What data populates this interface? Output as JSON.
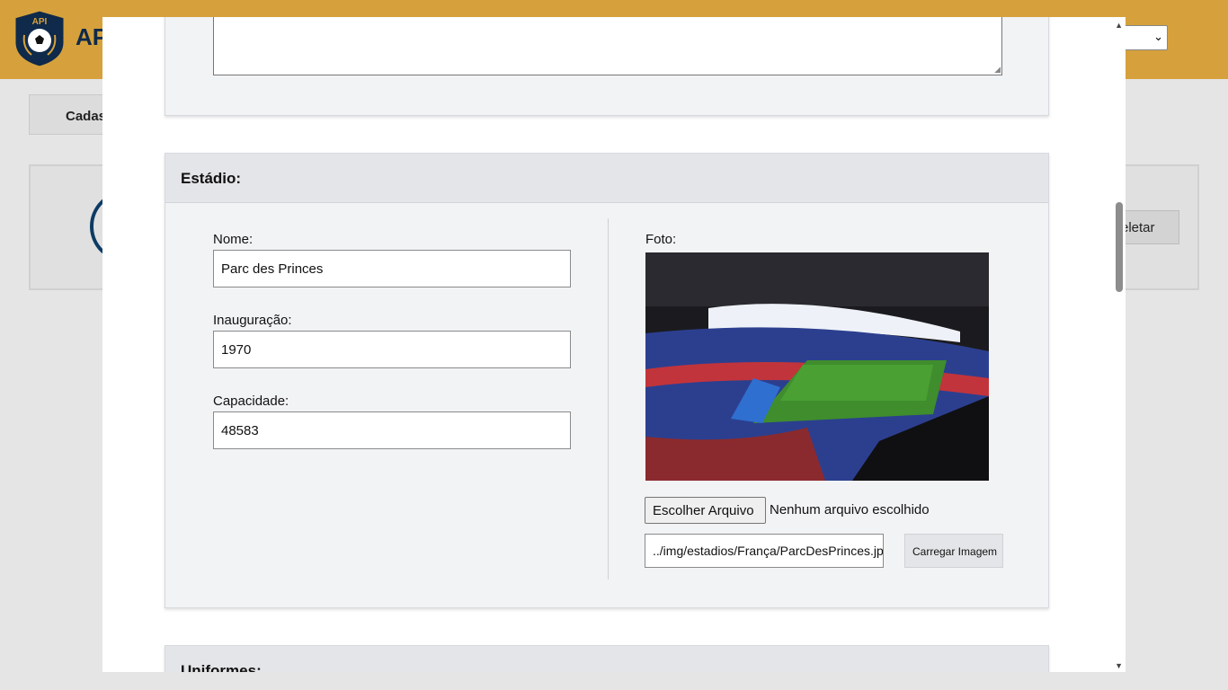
{
  "background": {
    "app_title": "API",
    "logo_text": "API",
    "tab_label": "Cadas",
    "delete_label": "eletar"
  },
  "stadium": {
    "header": "Estádio:",
    "name_label": "Nome:",
    "name_value": "Parc des Princes",
    "inauguration_label": "Inauguração:",
    "inauguration_value": "1970",
    "capacity_label": "Capacidade:",
    "capacity_value": "48583",
    "photo_label": "Foto:",
    "choose_file_label": "Escolher Arquivo",
    "file_status": "Nenhum arquivo escolhido",
    "image_path": "../img/estadios/França/ParcDesPrinces.jpg",
    "load_image_label": "Carregar Imagem"
  },
  "uniforms": {
    "header": "Uniformes:"
  },
  "colors": {
    "topbar": "#d6a13c",
    "section_bg": "#f2f3f5",
    "header_bg": "#e4e5e8",
    "navy": "#0f2a4a"
  }
}
